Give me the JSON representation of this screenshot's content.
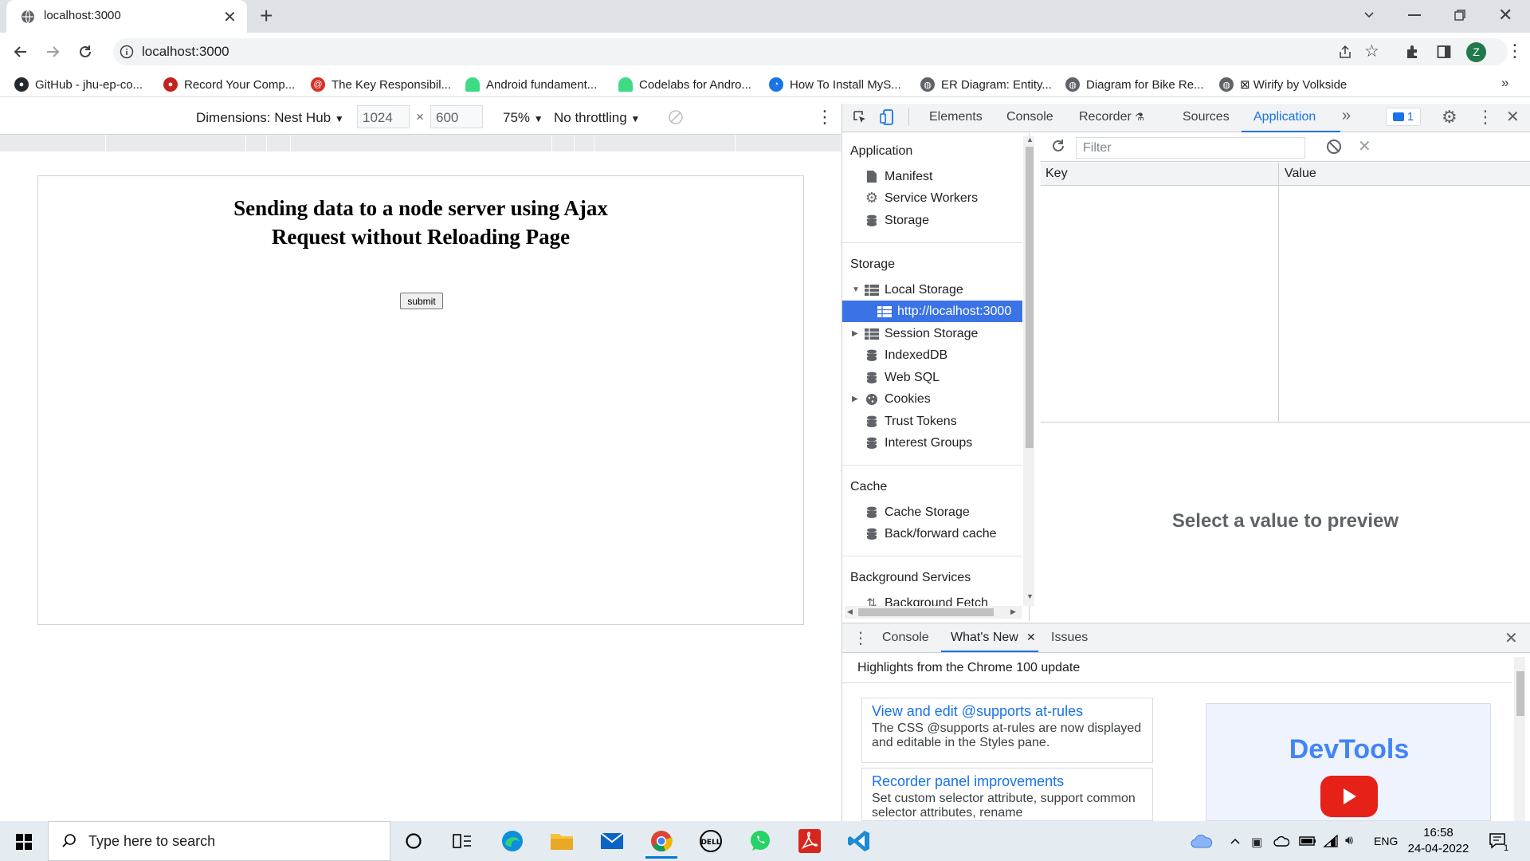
{
  "browser": {
    "tab_title": "localhost:3000",
    "url": "localhost:3000",
    "profile_initial": "Z",
    "bookmarks": [
      {
        "label": "GitHub - jhu-ep-co...",
        "color": "#24292f"
      },
      {
        "label": "Record Your Comp...",
        "color": "#c5221f"
      },
      {
        "label": "The Key Responsibil...",
        "color": "#d93025"
      },
      {
        "label": "Android fundament...",
        "color": "#3ddc84"
      },
      {
        "label": "Codelabs for Andro...",
        "color": "#3ddc84"
      },
      {
        "label": "How To Install MyS...",
        "color": "#1a73e8"
      },
      {
        "label": "ER Diagram: Entity...",
        "color": "#5f6368"
      },
      {
        "label": "Diagram for Bike Re...",
        "color": "#5f6368"
      },
      {
        "label": "⊠ Wirify by Volkside",
        "color": "#5f6368"
      }
    ]
  },
  "device_toolbar": {
    "dimensions": "Dimensions: Nest Hub",
    "width": "1024",
    "height": "600",
    "times": "×",
    "zoom": "75%",
    "throttling": "No throttling"
  },
  "page": {
    "heading": "Sending data to a node server using Ajax Request without Reloading Page",
    "submit_label": "submit"
  },
  "devtools": {
    "tabs": [
      "Elements",
      "Console",
      "Recorder",
      "Sources",
      "Application"
    ],
    "issues_count": "1",
    "sidebar": {
      "application_title": "Application",
      "application_items": [
        "Manifest",
        "Service Workers",
        "Storage"
      ],
      "storage_title": "Storage",
      "local_storage": "Local Storage",
      "local_storage_origin": "http://localhost:3000",
      "storage_items": [
        "Session Storage",
        "IndexedDB",
        "Web SQL",
        "Cookies",
        "Trust Tokens",
        "Interest Groups"
      ],
      "cache_title": "Cache",
      "cache_items": [
        "Cache Storage",
        "Back/forward cache"
      ],
      "background_title": "Background Services",
      "background_first": "Background Fetch"
    },
    "filter_placeholder": "Filter",
    "columns": {
      "key": "Key",
      "value": "Value"
    },
    "preview_text": "Select a value to preview",
    "drawer": {
      "tabs": [
        "Console",
        "What's New",
        "Issues"
      ],
      "highlights": "Highlights from the Chrome 100 update",
      "cards": [
        {
          "title": "View and edit @supports at-rules",
          "desc": "The CSS @supports at-rules are now displayed and editable in the Styles pane."
        },
        {
          "title": "Recorder panel improvements",
          "desc": "Set custom selector attribute, support common selector attributes, rename"
        }
      ],
      "video_title": "DevTools"
    }
  },
  "taskbar": {
    "search_placeholder": "Type here to search",
    "language": "ENG",
    "time": "16:58",
    "date": "24-04-2022",
    "notification_count": "1"
  }
}
